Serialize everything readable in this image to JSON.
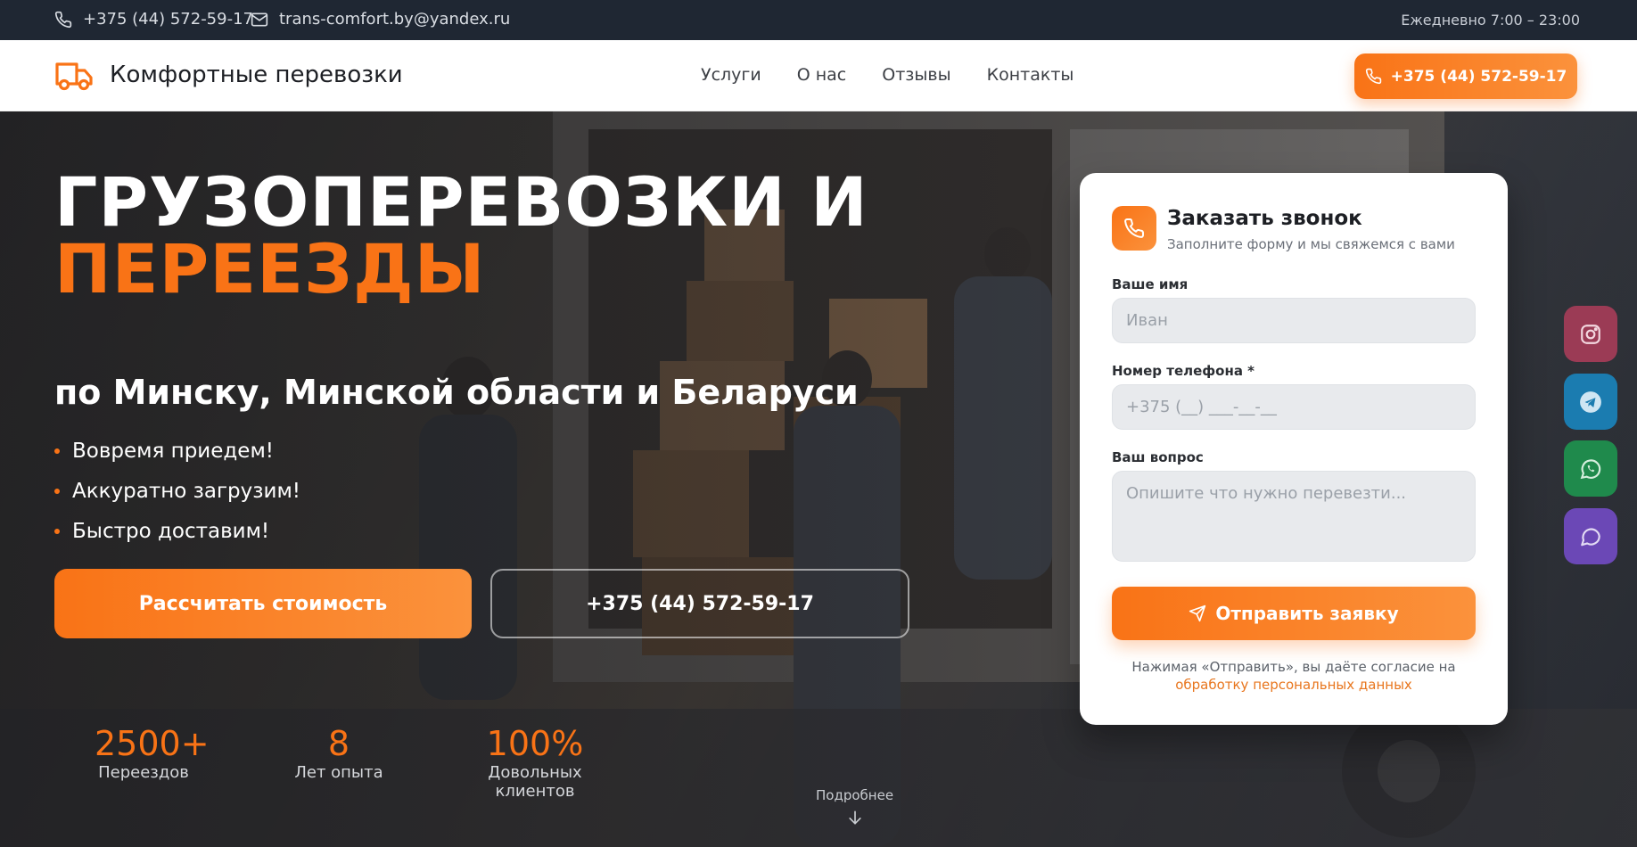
{
  "topbar": {
    "phone": "+375 (44) 572-59-17",
    "email": "trans-comfort.by@yandex.ru",
    "hours": "Ежедневно 7:00 – 23:00"
  },
  "header": {
    "logo_text": "Комфортные перевозки",
    "nav": [
      "Услуги",
      "О нас",
      "Отзывы",
      "Контакты"
    ],
    "phone_button": "+375 (44) 572-59-17"
  },
  "hero": {
    "title_line1": "ГРУЗОПЕРЕВОЗКИ И",
    "title_line2": "ПЕРЕЕЗДЫ",
    "subtitle": "по Минску, Минской области и Беларуси",
    "bullets": [
      "Вовремя приедем!",
      "Аккуратно загрузим!",
      "Быстро доставим!"
    ],
    "primary_button": "Рассчитать стоимость",
    "phone_button": "+375 (44) 572-59-17",
    "stats": [
      {
        "number": "2500+",
        "label": "Переездов"
      },
      {
        "number": "8",
        "label": "Лет опыта"
      },
      {
        "number": "100%",
        "label": "Довольных клиентов"
      }
    ],
    "more_label": "Подробнее"
  },
  "form": {
    "title": "Заказать звонок",
    "subtitle": "Заполните форму и мы свяжемся с вами",
    "name_label": "Ваше имя",
    "name_placeholder": "Иван",
    "phone_label": "Номер телефона *",
    "phone_placeholder": "+375 (__) ___-__-__",
    "question_label": "Ваш вопрос",
    "question_placeholder": "Опишите что нужно перевезти...",
    "submit_label": "Отправить заявку",
    "consent_text": "Нажимая «Отправить», вы даёте согласие на",
    "consent_link": "обработку персональных данных"
  },
  "social": [
    "instagram-icon",
    "telegram-icon",
    "whatsapp-icon",
    "chat-icon"
  ],
  "colors": {
    "accent": "#f97316",
    "topbar_bg": "#1f2733",
    "instagram": "#9b3b55",
    "telegram": "#1b7cb0",
    "whatsapp": "#1f8a4c",
    "chat": "#6b48b6"
  }
}
